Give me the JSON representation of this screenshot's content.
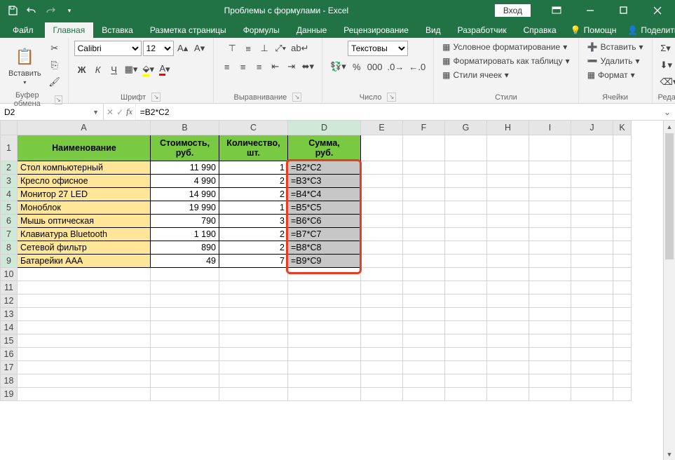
{
  "titlebar": {
    "title": "Проблемы с формулами  -  Excel",
    "login": "Вход"
  },
  "tabs": {
    "file": "Файл",
    "home": "Главная",
    "insert": "Вставка",
    "pagelayout": "Разметка страницы",
    "formulas": "Формулы",
    "data": "Данные",
    "review": "Рецензирование",
    "view": "Вид",
    "developer": "Разработчик",
    "help": "Справка",
    "tellme": "Помощн",
    "share": "Поделиться"
  },
  "ribbon": {
    "clipboard": {
      "label": "Буфер обмена",
      "paste": "Вставить"
    },
    "font": {
      "label": "Шрифт",
      "name": "Calibri",
      "size": "12",
      "bold": "Ж",
      "italic": "К",
      "underline": "Ч"
    },
    "alignment": {
      "label": "Выравнивание"
    },
    "number": {
      "label": "Число",
      "format": "Текстовы"
    },
    "styles": {
      "label": "Стили",
      "cond": "Условное форматирование",
      "table": "Форматировать как таблицу",
      "cell": "Стили ячеек"
    },
    "cells": {
      "label": "Ячейки",
      "insert": "Вставить",
      "delete": "Удалить",
      "format": "Формат"
    },
    "editing": {
      "label": "Редактирова..."
    }
  },
  "namebox": "D2",
  "formula": "=B2*C2",
  "columns": [
    "A",
    "B",
    "C",
    "D",
    "E",
    "F",
    "G",
    "H",
    "I",
    "J",
    "K"
  ],
  "headers": {
    "a": "Наименование",
    "b1": "Стоимость,",
    "b2": "руб.",
    "c1": "Количество,",
    "c2": "шт.",
    "d1": "Сумма,",
    "d2": "руб."
  },
  "rows": [
    {
      "n": "2",
      "name": "Стол компьютерный",
      "cost": "11 990",
      "qty": "1",
      "sum": "=B2*C2"
    },
    {
      "n": "3",
      "name": "Кресло офисное",
      "cost": "4 990",
      "qty": "2",
      "sum": "=B3*C3"
    },
    {
      "n": "4",
      "name": "Монитор 27 LED",
      "cost": "14 990",
      "qty": "2",
      "sum": "=B4*C4"
    },
    {
      "n": "5",
      "name": "Моноблок",
      "cost": "19 990",
      "qty": "1",
      "sum": "=B5*C5"
    },
    {
      "n": "6",
      "name": "Мышь оптическая",
      "cost": "790",
      "qty": "3",
      "sum": "=B6*C6"
    },
    {
      "n": "7",
      "name": "Клавиатура Bluetooth",
      "cost": "1 190",
      "qty": "2",
      "sum": "=B7*C7"
    },
    {
      "n": "8",
      "name": "Сетевой фильтр",
      "cost": "890",
      "qty": "2",
      "sum": "=B8*C8"
    },
    {
      "n": "9",
      "name": "Батарейки AAA",
      "cost": "49",
      "qty": "7",
      "sum": "=B9*C9"
    }
  ],
  "empty_rows": [
    "10",
    "11",
    "12",
    "13",
    "14",
    "15",
    "16",
    "17",
    "18",
    "19"
  ],
  "colwidths": {
    "A": 190,
    "B": 98,
    "C": 98,
    "D": 104,
    "E": 60,
    "F": 60,
    "G": 60,
    "H": 60,
    "I": 60,
    "J": 60,
    "K": 26
  }
}
